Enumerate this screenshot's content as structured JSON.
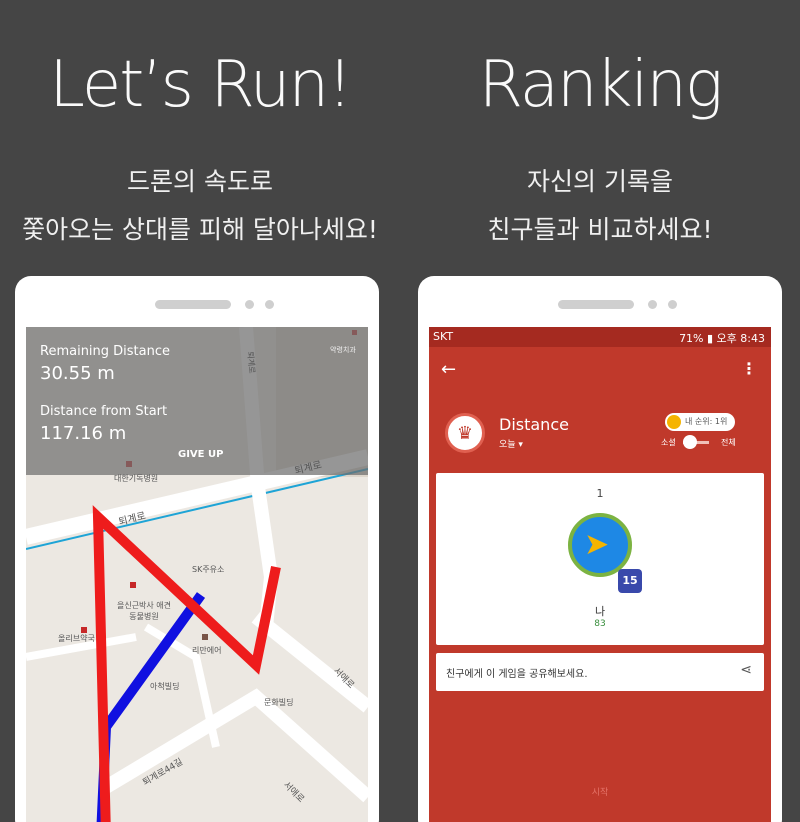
{
  "left": {
    "headline": "Let’s Run!",
    "sub1": "드론의 속도로",
    "sub2": "쫓아오는 상대를 피해 달아나세요!",
    "hud": {
      "remaining_label": "Remaining Distance",
      "remaining_value": "30.55 m",
      "from_start_label": "Distance from Start",
      "from_start_value": "117.16 m",
      "give_up": "GIVE UP"
    },
    "map_labels": [
      "퇴계로",
      "퇴계로",
      "퇴계로",
      "대한기독병원",
      "SK주유소",
      "을신근박사 애견동물병원",
      "올리브약국",
      "리만에어",
      "아척빌딩",
      "문화빌딩",
      "퇴계로44길",
      "서애로",
      "서애로",
      "약령치과"
    ]
  },
  "right": {
    "headline": "Ranking",
    "sub1": "자신의 기록을",
    "sub2": "친구들과 비교하세요!",
    "status": {
      "carrier": "SKT",
      "right": "71% ▮ 오후 8:43"
    },
    "title": "Distance",
    "period": "오늘 ▾",
    "rank_badge": "내 순위: 1위",
    "social": "소셜",
    "all": "전체",
    "rank_num": "1",
    "level": "15",
    "player_name": "나",
    "player_score": "83",
    "share_text": "친구에게 이 게임을 공유해보세요.",
    "start": "시작"
  },
  "colors": {
    "background": "#454545",
    "rank_red": "#c0392b",
    "route_red": "#ee1c1c",
    "route_blue": "#1010e0"
  }
}
